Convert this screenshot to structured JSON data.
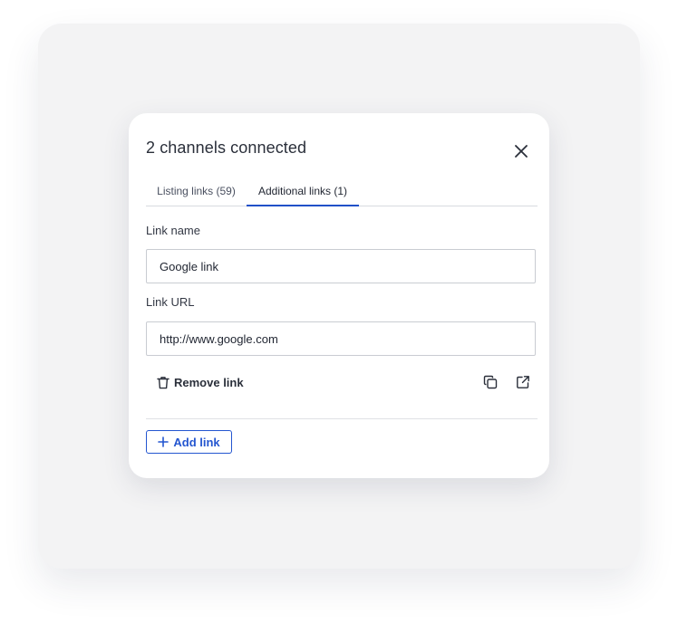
{
  "modal": {
    "title": "2 channels connected",
    "tabs": [
      {
        "label": "Listing links (59)",
        "active": false
      },
      {
        "label": "Additional links (1)",
        "active": true
      }
    ],
    "fields": {
      "link_name_label": "Link name",
      "link_name_value": "Google link",
      "link_url_label": "Link URL",
      "link_url_value": "http://www.google.com"
    },
    "actions": {
      "remove_label": "Remove link",
      "add_label": "Add link"
    },
    "icons": {
      "close": "close-icon",
      "trash": "trash-icon",
      "copy": "copy-icon",
      "external": "external-link-icon",
      "plus": "plus-icon"
    }
  },
  "colors": {
    "accent": "#2456d0",
    "tab_underline": "#2050c8",
    "backdrop": "#f3f3f4"
  }
}
